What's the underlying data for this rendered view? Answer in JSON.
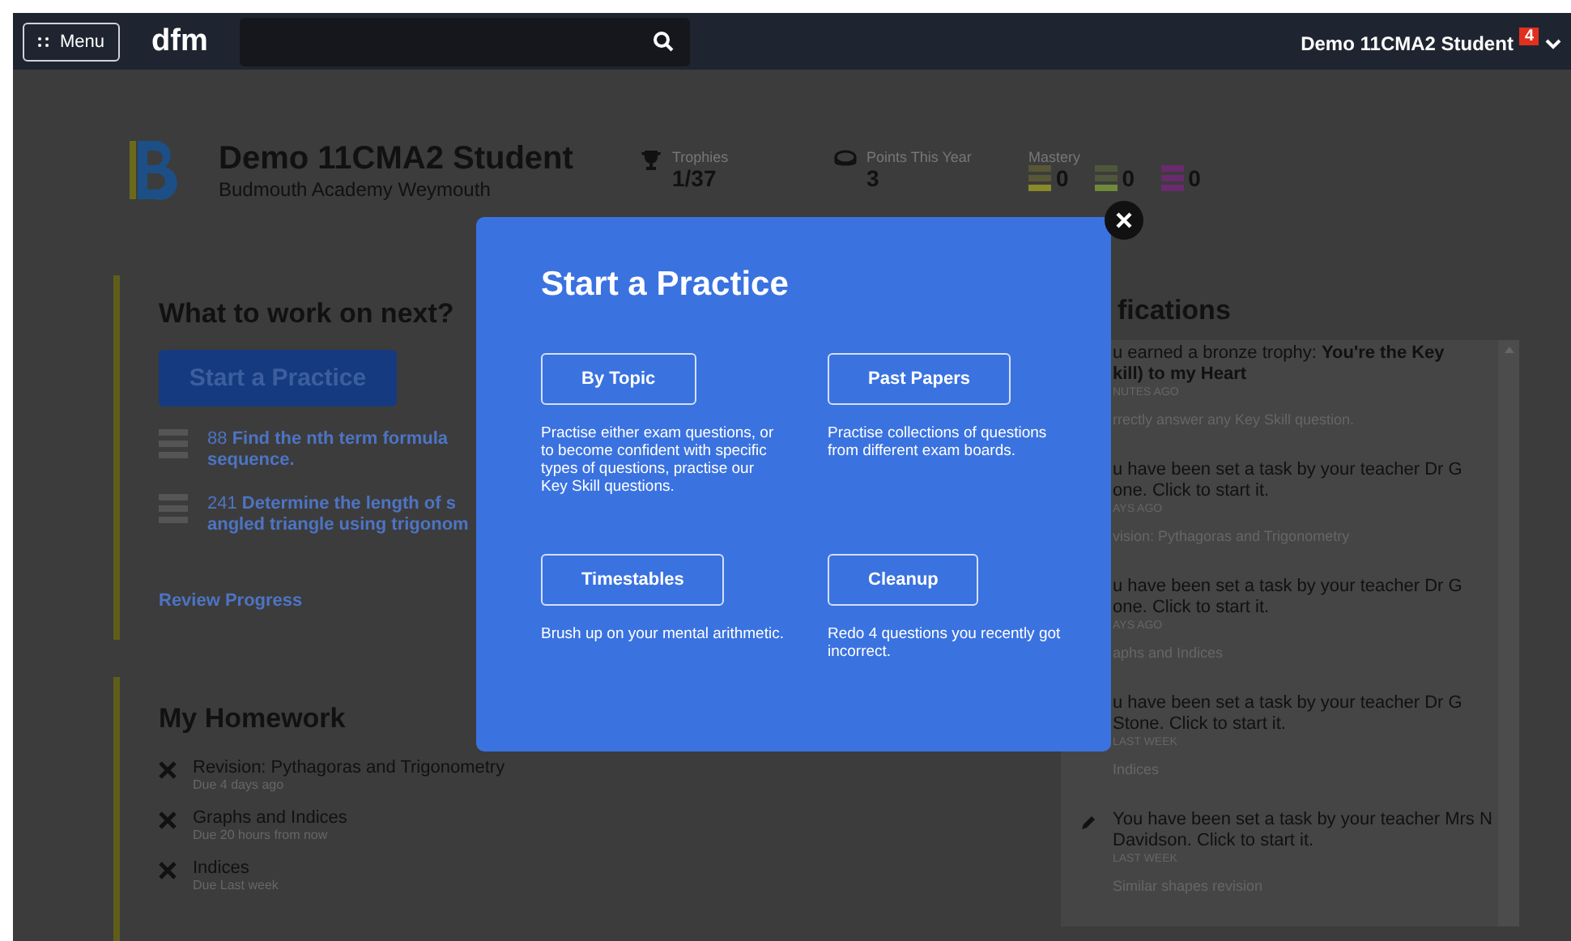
{
  "topbar": {
    "menu_label": "Menu",
    "logo": "dfm",
    "user": "Demo 11CMA2 Student",
    "badge": "4"
  },
  "profile": {
    "name": "Demo 11CMA2 Student",
    "school": "Budmouth Academy Weymouth",
    "stats": [
      {
        "kind": "trophy",
        "label": "Trophies",
        "value": "1/37"
      },
      {
        "kind": "points",
        "label": "Points This Year",
        "value": "3"
      }
    ],
    "mastery": {
      "label": "Mastery",
      "levels": [
        {
          "color": "#8a8a2a",
          "value": "0"
        },
        {
          "color": "#6f8a38",
          "value": "0"
        },
        {
          "color": "#6a2a6e",
          "value": "0"
        }
      ]
    }
  },
  "next": {
    "title": "What to work on next?",
    "button": "Start a Practice",
    "items": [
      {
        "number": "88",
        "lines": [
          "Find the nth term formula",
          "sequence."
        ]
      },
      {
        "number": "241",
        "lines": [
          "Determine the length of s",
          "angled triangle using trigonom"
        ]
      }
    ],
    "review": "Review Progress"
  },
  "homework": {
    "title": "My Homework",
    "items": [
      {
        "title": "Revision: Pythagoras and Trigonometry",
        "due": "Due 4 days ago"
      },
      {
        "title": "Graphs and Indices",
        "due": "Due 20 hours from now"
      },
      {
        "title": "Indices",
        "due": "Due Last week"
      }
    ]
  },
  "notifications": {
    "title": "fications",
    "items": [
      {
        "lines": [
          "u earned a bronze trophy: **You're the Key**",
          "**kill) to my Heart**"
        ],
        "time": "NUTES AGO",
        "detail": "rrectly answer any Key Skill question."
      },
      {
        "lines": [
          "u have been set a task by your teacher Dr G",
          "one. Click to start it."
        ],
        "time": "AYS AGO",
        "detail": "vision: Pythagoras and Trigonometry"
      },
      {
        "lines": [
          "u have been set a task by your teacher Dr G",
          "one. Click to start it."
        ],
        "time": "AYS AGO",
        "detail": "aphs and Indices"
      },
      {
        "lines": [
          "u have been set a task by your teacher Dr G",
          "Stone. Click to start it."
        ],
        "time": "LAST WEEK",
        "detail": "Indices"
      },
      {
        "kind": "task",
        "lines": [
          "You have been set a task by your teacher Mrs N",
          "Davidson. Click to start it."
        ],
        "time": "LAST WEEK",
        "detail": "Similar shapes revision"
      }
    ]
  },
  "modal": {
    "title": "Start a Practice",
    "options": [
      {
        "button": "By Topic",
        "text": "Practise either exam questions, or to become confident with specific types of questions, practise our Key Skill questions."
      },
      {
        "button": "Past Papers",
        "text": "Practise collections of questions from different exam boards."
      },
      {
        "button": "Timestables",
        "text": "Brush up on your mental arithmetic."
      },
      {
        "button": "Cleanup",
        "text": "Redo 4 questions you recently got incorrect."
      }
    ]
  }
}
